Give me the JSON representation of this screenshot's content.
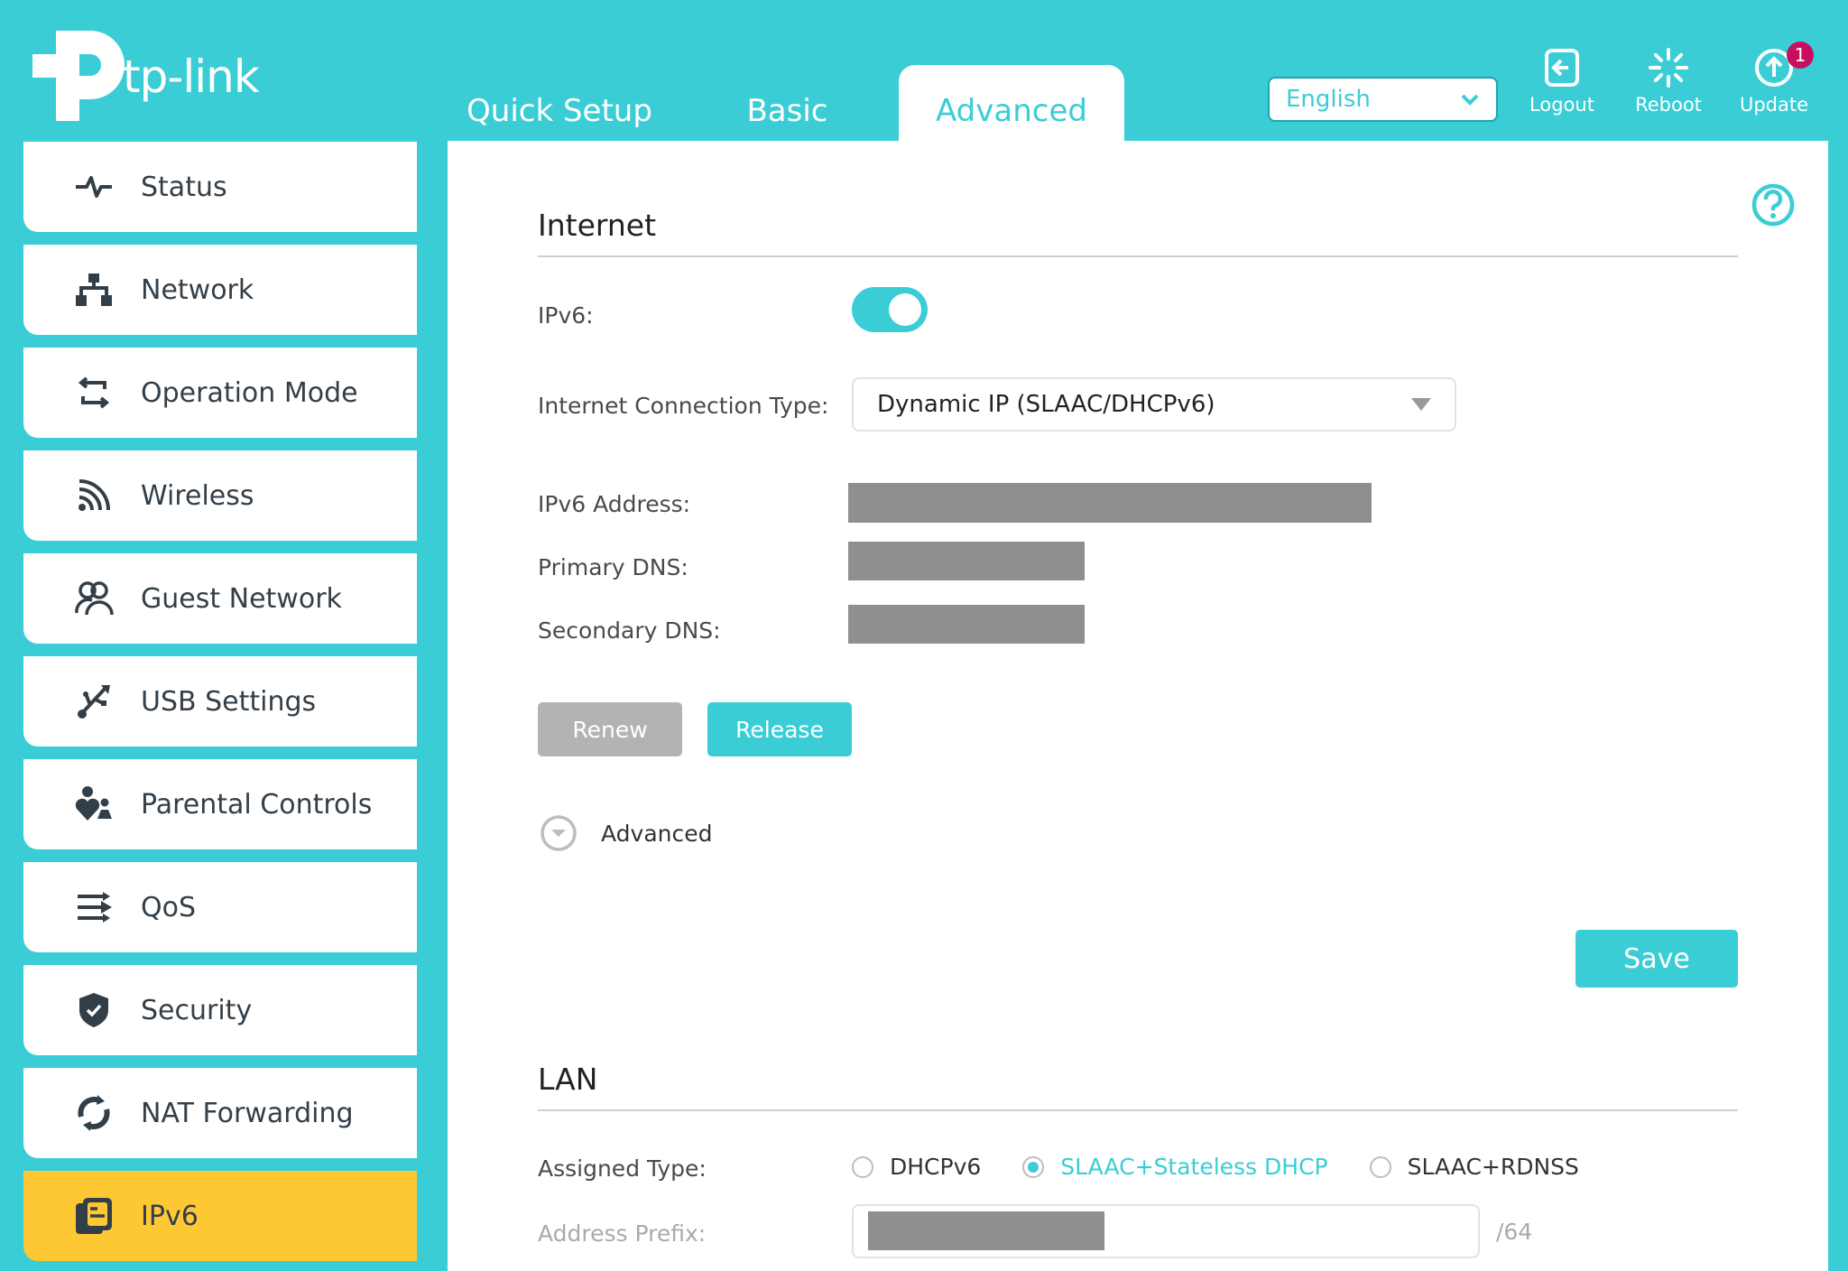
{
  "brand": {
    "name": "tp-link"
  },
  "colors": {
    "accent": "#3acdd5",
    "active_item": "#fec835",
    "badge": "#c7105d",
    "redacted": "#8f8f8f",
    "icon_dark": "#333f48"
  },
  "header": {
    "tabs": [
      {
        "label": "Quick Setup",
        "active": false
      },
      {
        "label": "Basic",
        "active": false
      },
      {
        "label": "Advanced",
        "active": true
      }
    ],
    "language": {
      "selected": "English",
      "icon": "chevron-down-icon"
    },
    "buttons": [
      {
        "label": "Logout",
        "icon": "logout-icon"
      },
      {
        "label": "Reboot",
        "icon": "reboot-icon"
      },
      {
        "label": "Update",
        "icon": "update-icon",
        "badge": "1"
      }
    ]
  },
  "sidebar": {
    "items": [
      {
        "label": "Status",
        "icon": "pulse-icon",
        "active": false
      },
      {
        "label": "Network",
        "icon": "network-topology-icon",
        "active": false
      },
      {
        "label": "Operation Mode",
        "icon": "swap-arrows-icon",
        "active": false
      },
      {
        "label": "Wireless",
        "icon": "wireless-icon",
        "active": false
      },
      {
        "label": "Guest Network",
        "icon": "users-icon",
        "active": false
      },
      {
        "label": "USB Settings",
        "icon": "usb-icon",
        "active": false
      },
      {
        "label": "Parental Controls",
        "icon": "parental-icon",
        "active": false
      },
      {
        "label": "QoS",
        "icon": "qos-arrows-icon",
        "active": false
      },
      {
        "label": "Security",
        "icon": "shield-check-icon",
        "active": false
      },
      {
        "label": "NAT Forwarding",
        "icon": "cycle-arrows-icon",
        "active": false
      },
      {
        "label": "IPv6",
        "icon": "ipv6-document-icon",
        "active": true
      }
    ]
  },
  "main": {
    "help_icon": "help-icon",
    "internet": {
      "title": "Internet",
      "ipv6_label": "IPv6:",
      "ipv6_enabled": true,
      "connection_type_label": "Internet Connection Type:",
      "connection_type_value": "Dynamic IP (SLAAC/DHCPv6)",
      "ipv6_address_label": "IPv6 Address:",
      "primary_dns_label": "Primary DNS:",
      "secondary_dns_label": "Secondary DNS:",
      "renew_label": "Renew",
      "release_label": "Release",
      "advanced_label": "Advanced",
      "save_label": "Save"
    },
    "lan": {
      "title": "LAN",
      "assigned_type_label": "Assigned Type:",
      "assigned_type_options": [
        {
          "label": "DHCPv6",
          "checked": false
        },
        {
          "label": "SLAAC+Stateless DHCP",
          "checked": true
        },
        {
          "label": "SLAAC+RDNSS",
          "checked": false
        }
      ],
      "address_prefix_label": "Address Prefix:",
      "address_prefix_suffix": "/64"
    }
  }
}
